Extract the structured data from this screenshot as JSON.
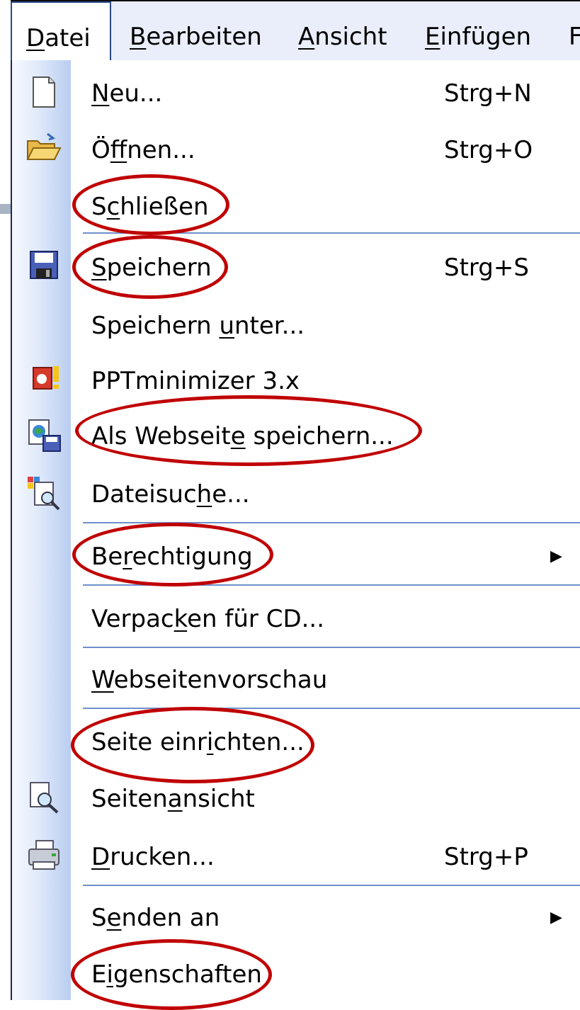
{
  "menubar": {
    "items": [
      {
        "label": "Datei",
        "u": "D",
        "rest": "atei"
      },
      {
        "label": "Bearbeiten",
        "u": "B",
        "rest": "earbeiten"
      },
      {
        "label": "Ansicht",
        "u": "A",
        "rest": "nsicht"
      },
      {
        "label": "Einfügen",
        "u": "E",
        "rest": "infügen"
      },
      {
        "label": "F"
      }
    ]
  },
  "menu": {
    "items": [
      {
        "pre": "",
        "u": "N",
        "post": "eu...",
        "label": "Neu...",
        "shortcut": "Strg+N",
        "icon": "new-document-icon"
      },
      {
        "pre": "Ö",
        "u": "f",
        "post": "fnen...",
        "label": "Öffnen...",
        "shortcut": "Strg+O",
        "icon": "open-folder-icon"
      },
      {
        "pre": "S",
        "u": "c",
        "post": "hließen",
        "label": "Schließen",
        "shortcut": "",
        "icon": ""
      },
      {
        "pre": "",
        "u": "S",
        "post": "peichern",
        "label": "Speichern",
        "shortcut": "Strg+S",
        "icon": "save-disk-icon"
      },
      {
        "pre": "Speichern ",
        "u": "u",
        "post": "nter...",
        "label": "Speichern unter...",
        "shortcut": "",
        "icon": ""
      },
      {
        "pre": "PPTminimizer 3.x",
        "u": "",
        "post": "",
        "label": "PPTminimizer 3.x",
        "shortcut": "",
        "icon": "pptminimizer-icon"
      },
      {
        "pre": "Als Webseit",
        "u": "e",
        "post": " speichern...",
        "label": "Als Webseite speichern...",
        "shortcut": "",
        "icon": "save-as-webpage-icon"
      },
      {
        "pre": "Dateisuc",
        "u": "h",
        "post": "e...",
        "label": "Dateisuche...",
        "shortcut": "",
        "icon": "file-search-icon"
      },
      {
        "pre": "Be",
        "u": "r",
        "post": "echtigung",
        "label": "Berechtigung",
        "shortcut": "",
        "icon": "",
        "submenu": "▶"
      },
      {
        "pre": "Verpac",
        "u": "k",
        "post": "en für CD...",
        "label": "Verpacken für CD...",
        "shortcut": "",
        "icon": ""
      },
      {
        "pre": "",
        "u": "W",
        "post": "ebseitenvorschau",
        "label": "Webseitenvorschau",
        "shortcut": "",
        "icon": ""
      },
      {
        "pre": "Seite einr",
        "u": "i",
        "post": "chten...",
        "label": "Seite einrichten...",
        "shortcut": "",
        "icon": ""
      },
      {
        "pre": "Seiten",
        "u": "a",
        "post": "nsicht",
        "label": "Seitenansicht",
        "shortcut": "",
        "icon": "print-preview-icon"
      },
      {
        "pre": "",
        "u": "D",
        "post": "rucken...",
        "label": "Drucken...",
        "shortcut": "Strg+P",
        "icon": "printer-icon"
      },
      {
        "pre": "S",
        "u": "e",
        "post": "nden an",
        "label": "Senden an",
        "shortcut": "",
        "icon": "",
        "submenu": "▶"
      },
      {
        "pre": "E",
        "u": "i",
        "post": "genschaften",
        "label": "Eigenschaften",
        "shortcut": "",
        "icon": ""
      }
    ]
  },
  "colors": {
    "highlight_oval": "#c00000",
    "separator": "#6f8fc9",
    "menubar_bg": "#eaeefa"
  }
}
